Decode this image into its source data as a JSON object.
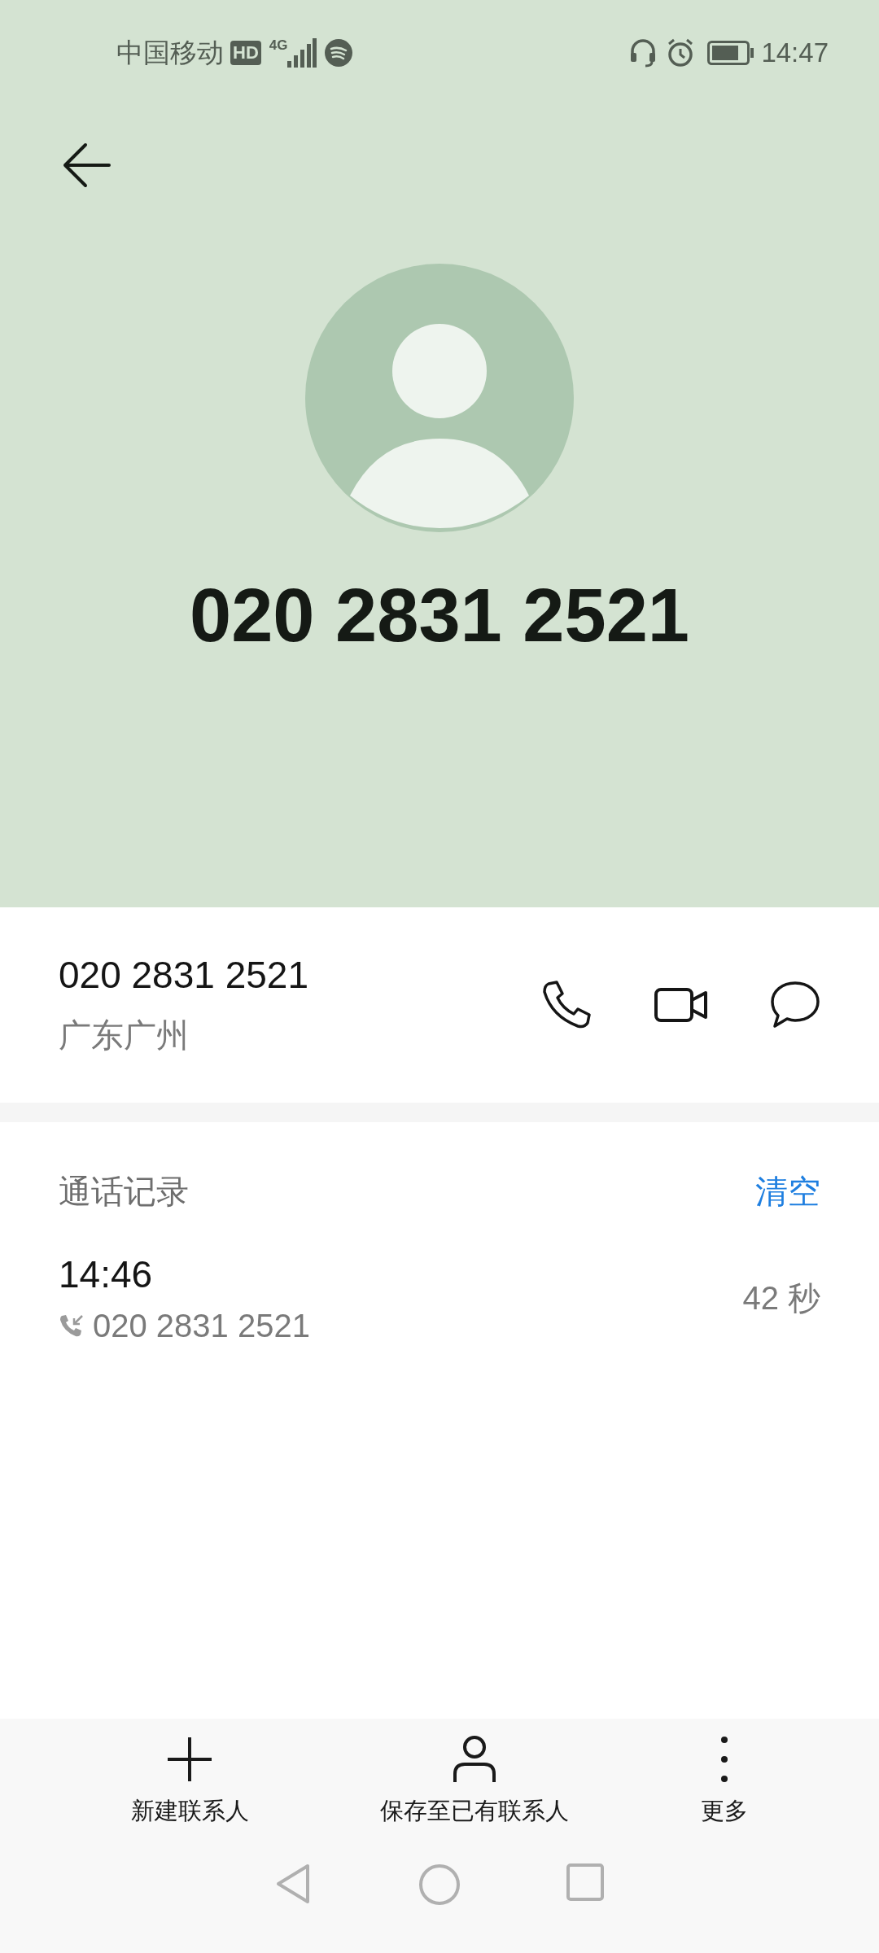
{
  "status_bar": {
    "carrier": "中国移动",
    "hd": "HD",
    "network": "4G",
    "time": "14:47"
  },
  "header": {
    "number": "020 2831 2521"
  },
  "contact": {
    "number": "020 2831 2521",
    "location": "广东广州"
  },
  "call_log": {
    "title": "通话记录",
    "clear": "清空",
    "entries": [
      {
        "time": "14:46",
        "kind": "incoming",
        "number": "020 2831 2521",
        "duration": "42 秒"
      }
    ]
  },
  "actions": [
    {
      "label": "新建联系人",
      "kind": "add"
    },
    {
      "label": "保存至已有联系人",
      "kind": "person"
    },
    {
      "label": "更多",
      "kind": "more"
    }
  ]
}
